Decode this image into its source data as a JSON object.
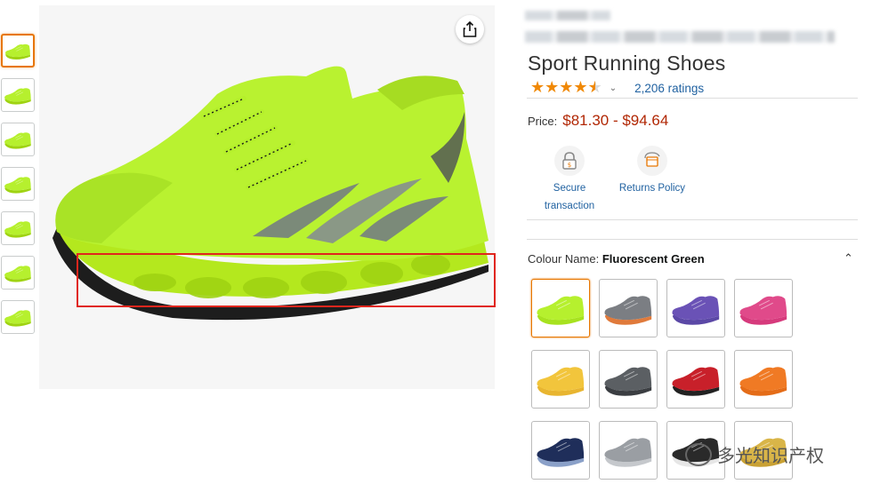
{
  "product": {
    "title": "Sport Running Shoes",
    "rating": 4.5,
    "ratings_count": "2,206 ratings",
    "price_label": "Price:",
    "price_value": "$81.30 - $94.64"
  },
  "features": [
    {
      "icon": "lock-icon",
      "label_line1": "Secure",
      "label_line2": "transaction"
    },
    {
      "icon": "return-box-icon",
      "label_line1": "Returns Policy",
      "label_line2": ""
    }
  ],
  "colour": {
    "label": "Colour Name:",
    "selected": "Fluorescent Green"
  },
  "swatches": [
    {
      "name": "fluorescent-green",
      "color": "#b6f02e",
      "sole": "#a7e21f",
      "selected": true
    },
    {
      "name": "grey-orange",
      "color": "#7b7e83",
      "sole": "#e07a3b"
    },
    {
      "name": "purple",
      "color": "#6a52b6",
      "sole": "#5b48a6"
    },
    {
      "name": "pink",
      "color": "#e04a8a",
      "sole": "#d63a7c"
    },
    {
      "name": "yellow",
      "color": "#f2c53c",
      "sole": "#e8b530"
    },
    {
      "name": "dark-grey",
      "color": "#5b5f63",
      "sole": "#3b3e42"
    },
    {
      "name": "red-black",
      "color": "#c8202a",
      "sole": "#222222"
    },
    {
      "name": "orange",
      "color": "#f07a24",
      "sole": "#e46c18"
    },
    {
      "name": "navy",
      "color": "#1f2e5a",
      "sole": "#8aa0c8"
    },
    {
      "name": "light-grey",
      "color": "#9a9ea3",
      "sole": "#c5c8cc"
    },
    {
      "name": "black-white",
      "color": "#2a2a2a",
      "sole": "#e6e6e6"
    },
    {
      "name": "gold",
      "color": "#d9b548",
      "sole": "#c9a134"
    }
  ],
  "thumbnails": [
    {
      "view": "side",
      "selected": true
    },
    {
      "view": "side-2"
    },
    {
      "view": "side-3"
    },
    {
      "view": "low"
    },
    {
      "view": "back"
    },
    {
      "view": "front"
    },
    {
      "view": "sole"
    }
  ],
  "watermark": {
    "text": "多光知识产权"
  },
  "colors": {
    "accent": "#e77600",
    "price": "#b12704",
    "link": "#2162a1",
    "highlight": "#e0261d"
  }
}
